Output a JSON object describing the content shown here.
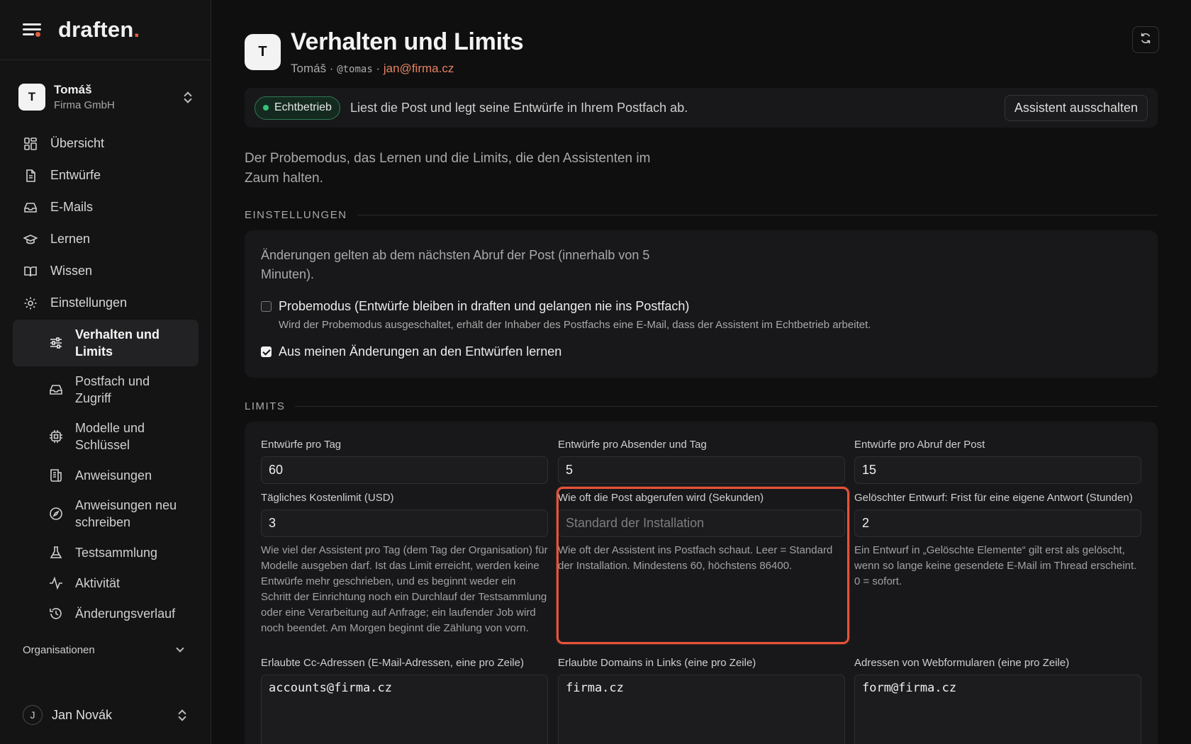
{
  "brand": {
    "name": "draften",
    "accent": "."
  },
  "account": {
    "initial": "T",
    "name": "Tomáš",
    "org": "Firma GmbH"
  },
  "nav": {
    "items": [
      {
        "label": "Übersicht",
        "icon": "dashboard-icon"
      },
      {
        "label": "Entwürfe",
        "icon": "document-icon"
      },
      {
        "label": "E-Mails",
        "icon": "inbox-icon"
      },
      {
        "label": "Lernen",
        "icon": "graduation-cap-icon"
      },
      {
        "label": "Wissen",
        "icon": "book-icon"
      },
      {
        "label": "Einstellungen",
        "icon": "gear-icon"
      }
    ],
    "sub_items": [
      {
        "label": "Verhalten und Limits",
        "icon": "sliders-icon",
        "active": true
      },
      {
        "label": "Postfach und Zugriff",
        "icon": "inbox-icon"
      },
      {
        "label": "Modelle und Schlüssel",
        "icon": "chip-icon"
      },
      {
        "label": "Anweisungen",
        "icon": "instructions-icon"
      },
      {
        "label": "Anweisungen neu schreiben",
        "icon": "compass-icon"
      },
      {
        "label": "Testsammlung",
        "icon": "flask-icon"
      },
      {
        "label": "Aktivität",
        "icon": "activity-icon"
      },
      {
        "label": "Änderungsverlauf",
        "icon": "history-icon"
      }
    ],
    "organizations_label": "Organisationen"
  },
  "user": {
    "initial": "J",
    "name": "Jan Novák"
  },
  "header": {
    "initial": "T",
    "title": "Verhalten und Limits",
    "name": "Tomáš",
    "separator": " · ",
    "handle": "@tomas",
    "email": "jan@firma.cz"
  },
  "status": {
    "badge": "Echtbetrieb",
    "text": "Liest die Post und legt seine Entwürfe in Ihrem Postfach ab.",
    "button": "Assistent ausschalten"
  },
  "intro": "Der Probemodus, das Lernen und die Limits, die den Assistenten im Zaum halten.",
  "settings": {
    "heading": "EINSTELLUNGEN",
    "note": "Änderungen gelten ab dem nächsten Abruf der Post (innerhalb von 5 Minuten).",
    "probe": {
      "label": "Probemodus (Entwürfe bleiben in draften und gelangen nie ins Postfach)",
      "help": "Wird der Probemodus ausgeschaltet, erhält der Inhaber des Postfachs eine E-Mail, dass der Assistent im Echtbetrieb arbeitet.",
      "checked": false
    },
    "learn": {
      "label": "Aus meinen Änderungen an den Entwürfen lernen",
      "checked": true
    }
  },
  "limits": {
    "heading": "LIMITS",
    "per_day": {
      "label": "Entwürfe pro Tag",
      "value": "60"
    },
    "per_sender": {
      "label": "Entwürfe pro Absender und Tag",
      "value": "5"
    },
    "per_fetch": {
      "label": "Entwürfe pro Abruf der Post",
      "value": "15"
    },
    "cost": {
      "label": "Tägliches Kostenlimit (USD)",
      "value": "3",
      "help": "Wie viel der Assistent pro Tag (dem Tag der Organisation) für Modelle ausgeben darf. Ist das Limit erreicht, werden keine Entwürfe mehr geschrieben, und es beginnt weder ein Schritt der Einrichtung noch ein Durchlauf der Testsammlung oder eine Verarbeitung auf Anfrage; ein laufender Job wird noch beendet. Am Morgen beginnt die Zählung von vorn."
    },
    "poll": {
      "label": "Wie oft die Post abgerufen wird (Sekunden)",
      "placeholder": "Standard der Installation",
      "help": "Wie oft der Assistent ins Postfach schaut. Leer = Standard der Installation. Mindestens 60, höchstens 86400."
    },
    "deleted": {
      "label": "Gelöschter Entwurf: Frist für eine eigene Antwort (Stunden)",
      "value": "2",
      "help": "Ein Entwurf in „Gelöschte Elemente“ gilt erst als gelöscht, wenn so lange keine gesendete E-Mail im Thread erscheint. 0 = sofort."
    },
    "cc": {
      "label": "Erlaubte Cc-Adressen (E-Mail-Adressen, eine pro Zeile)",
      "value": "accounts@firma.cz"
    },
    "domains": {
      "label": "Erlaubte Domains in Links (eine pro Zeile)",
      "value": "firma.cz"
    },
    "webforms": {
      "label": "Adressen von Webformularen (eine pro Zeile)",
      "value": "form@firma.cz"
    }
  },
  "colors": {
    "accent": "#e2603f",
    "highlight": "#e5533b",
    "status_green": "#34c27a"
  }
}
